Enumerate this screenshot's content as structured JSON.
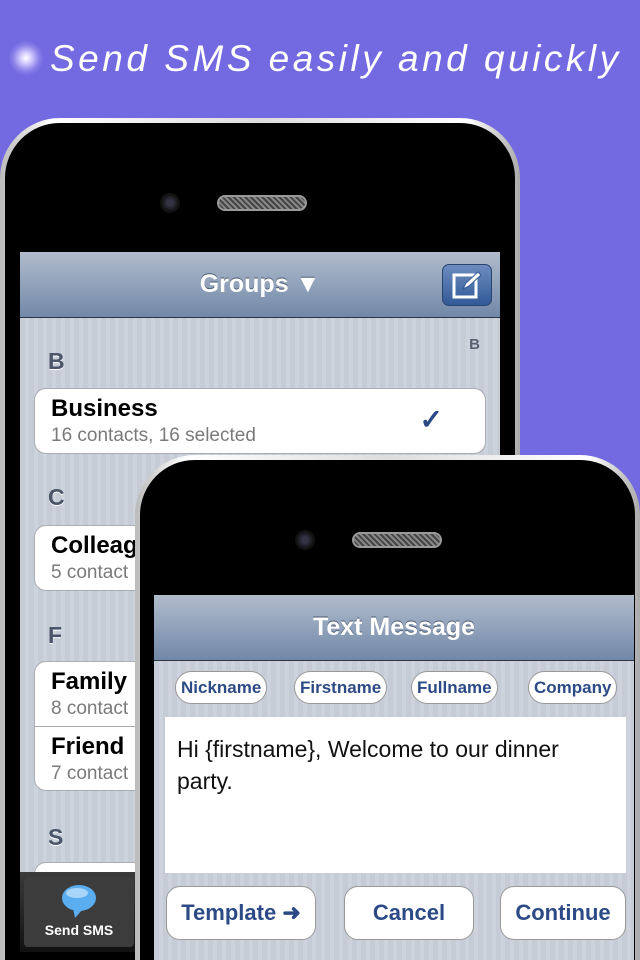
{
  "headline": "Send SMS easily and quickly",
  "groups_screen": {
    "title": "Groups ▼",
    "index_letter": "B",
    "sections": [
      {
        "letter": "B",
        "items": [
          {
            "name": "Business",
            "detail": "16 contacts, 16 selected",
            "checked": true
          }
        ]
      },
      {
        "letter": "C",
        "items": [
          {
            "name": "Colleag",
            "detail": "5 contact"
          }
        ]
      },
      {
        "letter": "F",
        "items": [
          {
            "name": "Family",
            "detail": "8 contact"
          },
          {
            "name": "Friend",
            "detail": "7 contact"
          }
        ]
      },
      {
        "letter": "S",
        "items": []
      }
    ],
    "tab": {
      "label": "Send SMS",
      "icon": "speech-bubble-icon"
    }
  },
  "message_screen": {
    "title": "Text Message",
    "placeholders": [
      "Nickname",
      "Firstname",
      "Fullname",
      "Company"
    ],
    "message": "Hi {firstname}, Welcome to our dinner party.",
    "buttons": {
      "template": "Template ➜",
      "cancel": "Cancel",
      "continue": "Continue"
    }
  },
  "colors": {
    "background": "#7369e1",
    "accent": "#2c4a86"
  }
}
